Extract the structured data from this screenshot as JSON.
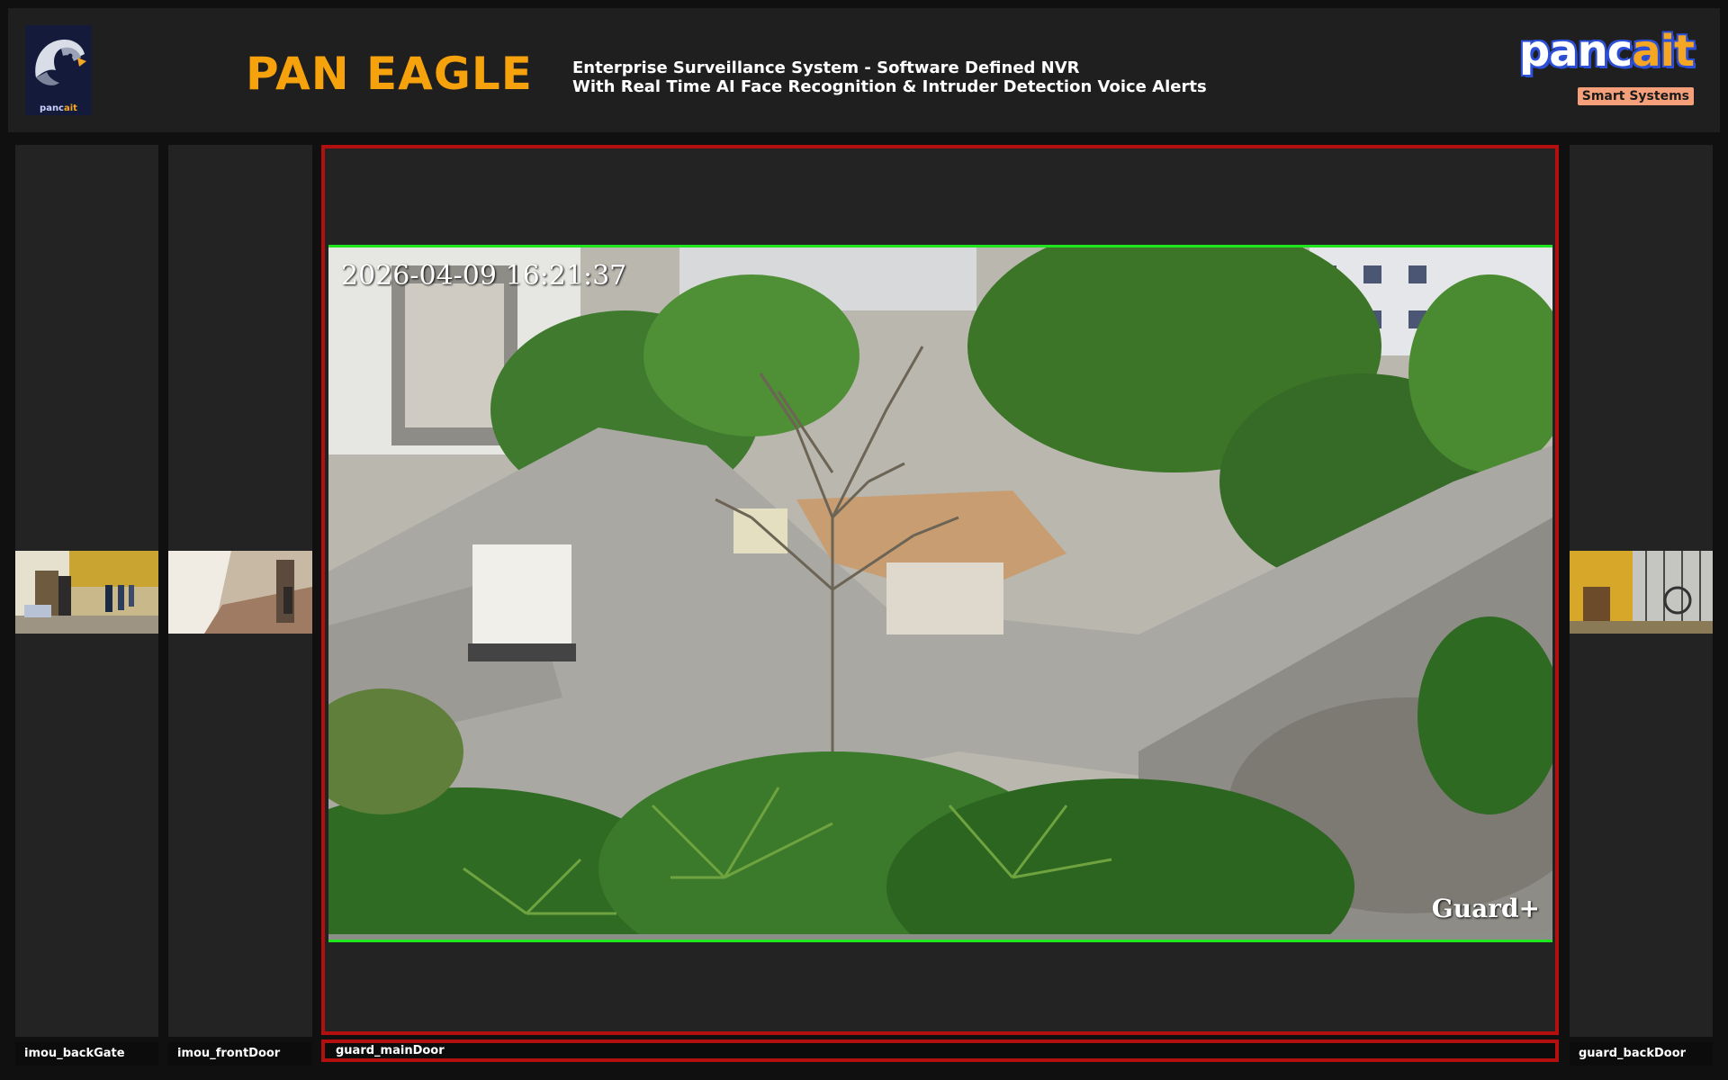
{
  "header": {
    "logo_text_main": "panc",
    "logo_text_accent": "ait",
    "title": "PAN EAGLE",
    "subtitle_line1": "Enterprise Surveillance System - Software Defined NVR",
    "subtitle_line2": "With Real Time AI Face Recognition & Intruder Detection Voice Alerts",
    "brand_main": "panc",
    "brand_accent": "ait",
    "brand_tagline": "Smart Systems"
  },
  "colors": {
    "title": "#f5a20c",
    "active_border": "#b40f0f",
    "video_border": "#1fe61f",
    "brand_blue": "#2d4fd6",
    "brand_orange": "#f5a623"
  },
  "cameras": [
    {
      "name": "imou_backGate"
    },
    {
      "name": "imou_frontDoor"
    },
    {
      "name": "guard_mainDoor",
      "active": true,
      "osd_time": "2026-04-09 16:21:37",
      "osd_brand": "Guard+"
    },
    {
      "name": "guard_backDoor"
    }
  ]
}
